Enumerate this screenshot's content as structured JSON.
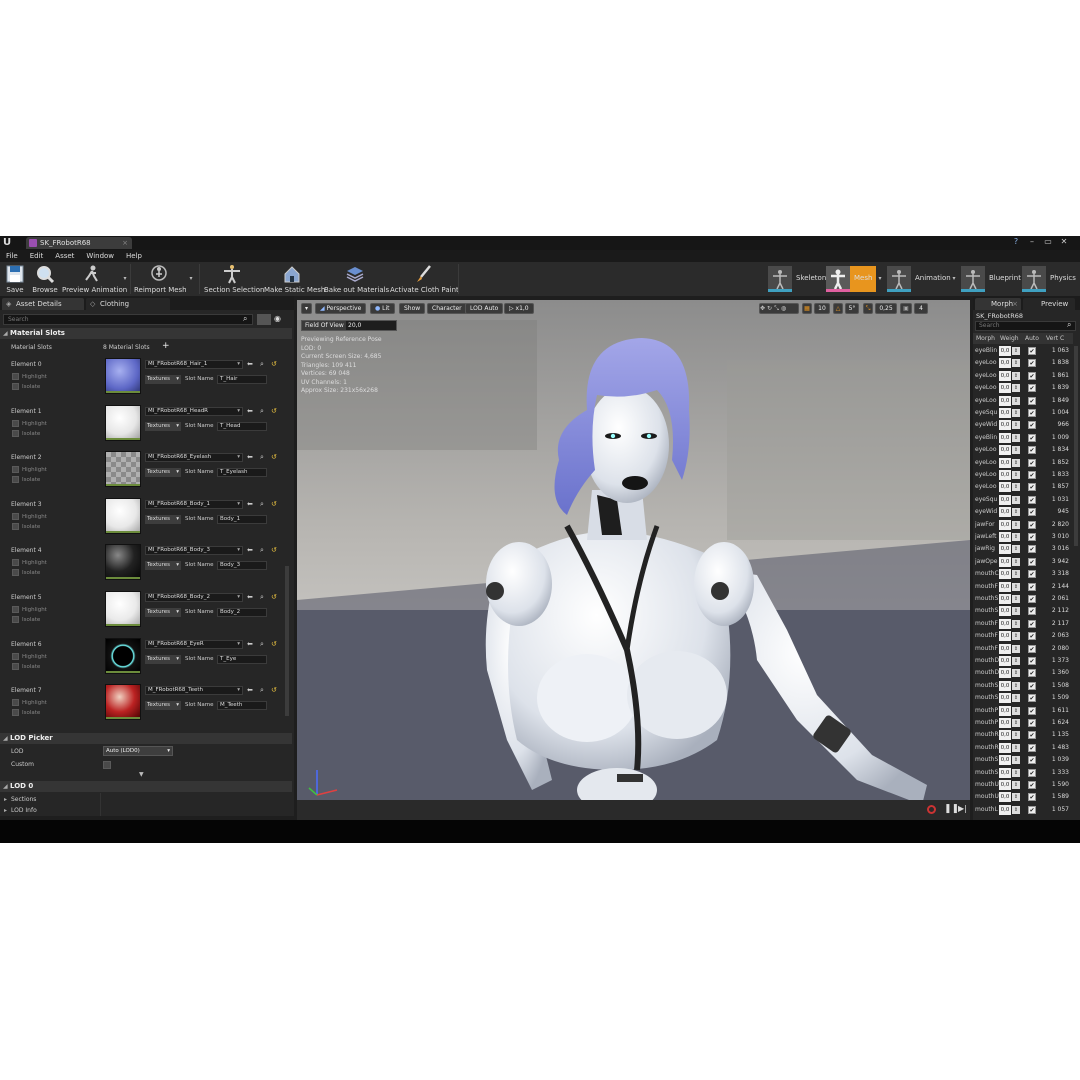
{
  "window": {
    "tab_title": "SK_FRobotR68",
    "min": "–",
    "max": "▭",
    "close": "✕",
    "help": "?",
    "logo": "U"
  },
  "menu": [
    "File",
    "Edit",
    "Asset",
    "Window",
    "Help"
  ],
  "toolbar": {
    "save": "Save",
    "browse": "Browse",
    "preview_animation": "Preview Animation",
    "reimport_mesh": "Reimport Mesh",
    "section_selection": "Section Selection",
    "make_static_mesh": "Make Static Mesh",
    "bake_out_materials": "Bake out Materials",
    "activate_cloth_paint": "Activate Cloth Paint"
  },
  "modes": {
    "skeleton": "Skeleton",
    "mesh": "Mesh",
    "animation": "Animation",
    "blueprint": "Blueprint",
    "physics": "Physics"
  },
  "left_tabs": {
    "asset_details": "Asset Details",
    "clothing": "Clothing"
  },
  "search_placeholder": "Search",
  "material_section": {
    "title": "Material Slots",
    "row_label": "Material Slots",
    "count": "8 Material Slots",
    "add": "+"
  },
  "option_labels": {
    "highlight": "Highlight",
    "isolate": "Isolate",
    "textures": "Textures",
    "slot_name": "Slot Name"
  },
  "elements": [
    {
      "name": "Element 0",
      "material": "MI_FRobotR68_Hair_1",
      "slot": "T_Hair"
    },
    {
      "name": "Element 1",
      "material": "MI_FRobotR68_HeadR",
      "slot": "T_Head"
    },
    {
      "name": "Element 2",
      "material": "MI_FRobotR68_Eyelash",
      "slot": "T_Eyelash"
    },
    {
      "name": "Element 3",
      "material": "MI_FRobotR68_Body_1",
      "slot": "Body_1"
    },
    {
      "name": "Element 4",
      "material": "MI_FRobotR68_Body_3",
      "slot": "Body_3"
    },
    {
      "name": "Element 5",
      "material": "MI_FRobotR68_Body_2",
      "slot": "Body_2"
    },
    {
      "name": "Element 6",
      "material": "MI_FRobotR68_EyeR",
      "slot": "T_Eye"
    },
    {
      "name": "Element 7",
      "material": "M_FRobotR68_Teeth",
      "slot": "M_Teeth"
    }
  ],
  "lod_picker": {
    "title": "LOD Picker",
    "lod_label": "LOD",
    "lod_value": "Auto (LOD0)",
    "custom_label": "Custom"
  },
  "lod0": {
    "title": "LOD 0",
    "sections": "Sections",
    "lod_info": "LOD Info"
  },
  "viewport": {
    "perspective": "Perspective",
    "lit": "Lit",
    "show": "Show",
    "character": "Character",
    "lod_auto": "LOD Auto",
    "speed": "x1,0",
    "fov_label": "Field Of View",
    "fov_value": "20,0",
    "grid_snap": "10",
    "rot_snap": "5°",
    "scale_snap": "0,25",
    "cam_speed": "4",
    "stats": [
      "Previewing Reference Pose",
      "LOD: 0",
      "Current Screen Size: 4,685",
      "Triangles: 109 411",
      "Vertices: 69 048",
      "UV Channels: 1",
      "Approx Size: 231x56x268"
    ]
  },
  "right_panel": {
    "tab_morph": "Morph",
    "tab_preview": "Preview",
    "name": "SK_FRobotR68",
    "search": "Search",
    "cols": [
      "Morph",
      "Weigh",
      "Auto",
      "Vert C"
    ]
  },
  "morphs": [
    {
      "n": "eyeBlin",
      "w": "0,0",
      "v": "1 063"
    },
    {
      "n": "eyeLoo",
      "w": "0,0",
      "v": "1 838"
    },
    {
      "n": "eyeLoo",
      "w": "0,0",
      "v": "1 861"
    },
    {
      "n": "eyeLoo",
      "w": "0,0",
      "v": "1 839"
    },
    {
      "n": "eyeLoo",
      "w": "0,0",
      "v": "1 849"
    },
    {
      "n": "eyeSqu",
      "w": "0,0",
      "v": "1 004"
    },
    {
      "n": "eyeWid",
      "w": "0,0",
      "v": "966"
    },
    {
      "n": "eyeBlin",
      "w": "0,0",
      "v": "1 009"
    },
    {
      "n": "eyeLoo",
      "w": "0,0",
      "v": "1 834"
    },
    {
      "n": "eyeLoo",
      "w": "0,0",
      "v": "1 852"
    },
    {
      "n": "eyeLoo",
      "w": "0,0",
      "v": "1 833"
    },
    {
      "n": "eyeLoo",
      "w": "0,0",
      "v": "1 857"
    },
    {
      "n": "eyeSqu",
      "w": "0,0",
      "v": "1 031"
    },
    {
      "n": "eyeWid",
      "w": "0,0",
      "v": "945"
    },
    {
      "n": "jawFor",
      "w": "0,0",
      "v": "2 820"
    },
    {
      "n": "jawLeft",
      "w": "0,0",
      "v": "3 010"
    },
    {
      "n": "jawRig",
      "w": "0,0",
      "v": "3 016"
    },
    {
      "n": "jawOpe",
      "w": "0,0",
      "v": "3 942"
    },
    {
      "n": "mouthC",
      "w": "0,0",
      "v": "3 318"
    },
    {
      "n": "mouthF",
      "w": "0,0",
      "v": "2 144"
    },
    {
      "n": "mouthS",
      "w": "0,0",
      "v": "2 061"
    },
    {
      "n": "mouthS",
      "w": "0,0",
      "v": "2 112"
    },
    {
      "n": "mouthF",
      "w": "0,0",
      "v": "2 117"
    },
    {
      "n": "mouthF",
      "w": "0,0",
      "v": "2 063"
    },
    {
      "n": "mouthF",
      "w": "0,0",
      "v": "2 080"
    },
    {
      "n": "mouthD",
      "w": "0,0",
      "v": "1 373"
    },
    {
      "n": "mouthD",
      "w": "0,0",
      "v": "1 360"
    },
    {
      "n": "mouthS",
      "w": "0,0",
      "v": "1 508"
    },
    {
      "n": "mouthS",
      "w": "0,0",
      "v": "1 509"
    },
    {
      "n": "mouthP",
      "w": "0,0",
      "v": "1 611"
    },
    {
      "n": "mouthP",
      "w": "0,0",
      "v": "1 624"
    },
    {
      "n": "mouthR",
      "w": "0,0",
      "v": "1 135"
    },
    {
      "n": "mouthR",
      "w": "0,0",
      "v": "1 483"
    },
    {
      "n": "mouthS",
      "w": "0,0",
      "v": "1 039"
    },
    {
      "n": "mouthS",
      "w": "0,0",
      "v": "1 333"
    },
    {
      "n": "mouthU",
      "w": "0,0",
      "v": "1 590"
    },
    {
      "n": "mouthU",
      "w": "0,0",
      "v": "1 589"
    },
    {
      "n": "mouthL",
      "w": "0,0",
      "v": "1 057"
    }
  ],
  "colors": {
    "accent": "#e8951e",
    "hair": "#7d86d6",
    "bg": "#1e1e1e"
  }
}
